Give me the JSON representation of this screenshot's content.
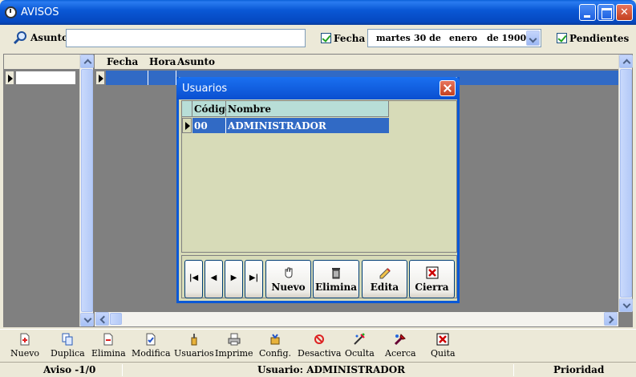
{
  "window": {
    "title": "AVISOS"
  },
  "search": {
    "asunto_label": "Asunto:",
    "asunto_value": ""
  },
  "filters": {
    "fecha_label": "Fecha",
    "fecha_checked": true,
    "date": {
      "day_name": "martes",
      "day": "30 de",
      "month": "enero",
      "year": "de 1900"
    },
    "pendientes_label": "Pendientes",
    "pendientes_checked": true
  },
  "main_grid": {
    "columns": [
      "Fecha",
      "Hora",
      "Asunto"
    ]
  },
  "modal": {
    "title": "Usuarios",
    "columns": [
      "Código",
      "Nombre"
    ],
    "rows": [
      {
        "codigo": "00",
        "nombre": "ADMINISTRADOR"
      }
    ],
    "nav": {
      "first": "|◀",
      "prev": "◀",
      "next": "▶",
      "last": "▶|"
    },
    "buttons": {
      "nuevo": "Nuevo",
      "elimina": "Elimina",
      "edita": "Edita",
      "cierra": "Cierra"
    }
  },
  "toolbar": {
    "items": [
      {
        "label": "Nuevo",
        "icon": "new-icon"
      },
      {
        "label": "Duplica",
        "icon": "duplicate-icon"
      },
      {
        "label": "Elimina",
        "icon": "delete-icon"
      },
      {
        "label": "Modifica",
        "icon": "edit-icon"
      },
      {
        "label": "Usuarios",
        "icon": "users-icon"
      },
      {
        "label": "Imprime",
        "icon": "printer-icon"
      },
      {
        "label": "Config.",
        "icon": "config-icon"
      },
      {
        "label": "Desactiva",
        "icon": "deactivate-icon"
      },
      {
        "label": "Oculta",
        "icon": "hide-icon"
      },
      {
        "label": "Acerca",
        "icon": "about-icon"
      },
      {
        "label": "Quita",
        "icon": "exit-icon"
      }
    ]
  },
  "status": {
    "aviso": "Aviso -1/0",
    "usuario": "Usuario: ADMINISTRADOR",
    "prioridad": "Prioridad"
  },
  "colors": {
    "titlebar": "#0a58d6",
    "selection": "#316ac5",
    "modal_bg": "#d7dbb8",
    "modal_header": "#b8ded7"
  }
}
